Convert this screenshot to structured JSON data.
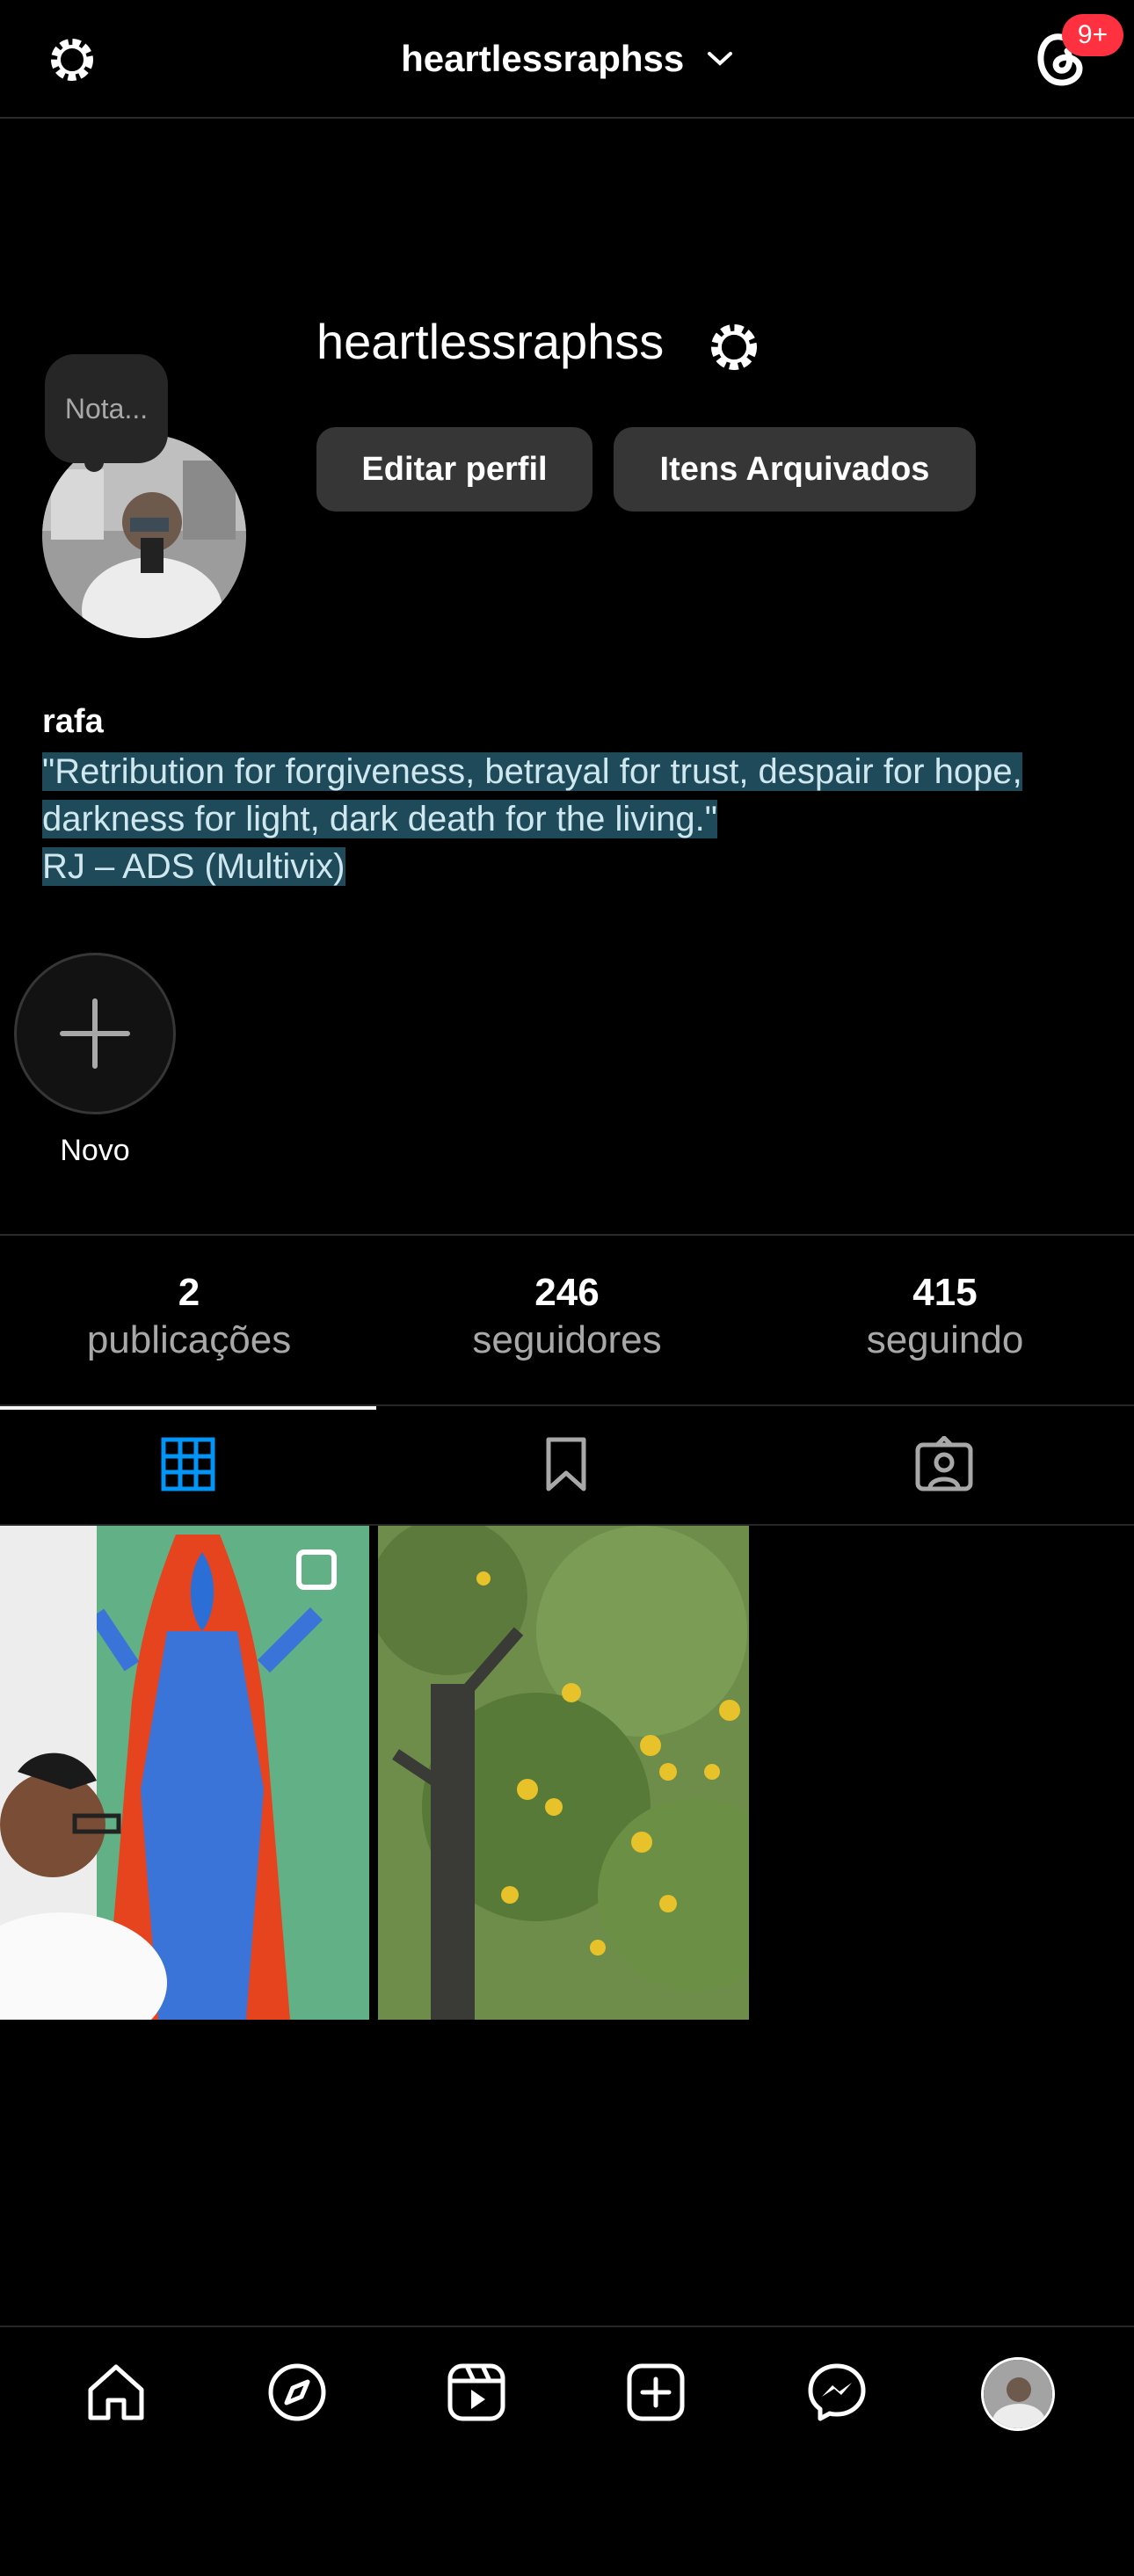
{
  "header": {
    "username": "heartlessraphss",
    "notification_badge": "9+",
    "badge_color": "#ff3040"
  },
  "profile": {
    "name": "heartlessraphss",
    "note_placeholder": "Nota...",
    "edit_button": "Editar perfil",
    "archive_button": "Itens Arquivados",
    "display_name": "rafa",
    "bio": [
      "\"Retribution for forgiveness, betrayal for trust, despair for hope,",
      "darkness for light, dark death for the living.\"",
      "RJ – ADS (Multivix)"
    ]
  },
  "highlights": {
    "new_label": "Novo"
  },
  "stats": [
    {
      "value": "2",
      "label": "publicações"
    },
    {
      "value": "246",
      "label": "seguidores"
    },
    {
      "value": "415",
      "label": "seguindo"
    }
  ],
  "tabs": [
    "grid-icon",
    "saved-icon",
    "tagged-icon"
  ],
  "accent_color": "#0095f6",
  "bottom_nav": [
    "home-icon",
    "explore-icon",
    "reels-icon",
    "create-icon",
    "messenger-icon",
    "profile-avatar"
  ]
}
